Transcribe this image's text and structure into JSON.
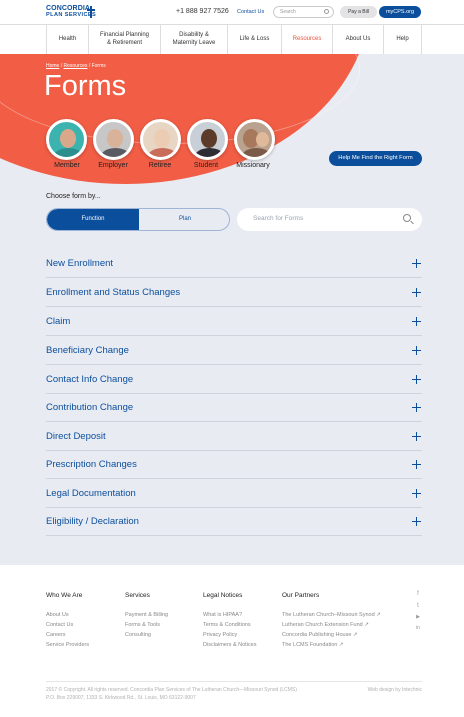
{
  "header": {
    "logo_line1": "CONCORDIA",
    "logo_line2": "PLAN SERVICES",
    "phone": "+1 888 927 7526",
    "contact": "Contact Us",
    "search_placeholder": "Search",
    "pay_bill": "Pay a Bill",
    "mycps": "myCPS.org"
  },
  "nav": [
    {
      "label": "Health"
    },
    {
      "label": "Financial Planning\n& Retirement"
    },
    {
      "label": "Disability &\nMaternity Leave"
    },
    {
      "label": "Life & Loss"
    },
    {
      "label": "Resources"
    },
    {
      "label": "About Us"
    },
    {
      "label": "Help"
    }
  ],
  "breadcrumb": {
    "home": "Home",
    "sep": "/",
    "resources": "Resources",
    "current": "Forms"
  },
  "page_title": "Forms",
  "audiences": [
    {
      "label": "Member"
    },
    {
      "label": "Employer"
    },
    {
      "label": "Retiree"
    },
    {
      "label": "Student"
    },
    {
      "label": "Missionary"
    }
  ],
  "help_button": "Help Me Find the Right Form",
  "choose_label": "Choose form by...",
  "toggle": {
    "function": "Function",
    "plan": "Plan"
  },
  "forms_search_placeholder": "Search for Forms",
  "accordion": [
    "New Enrollment",
    "Enrollment and Status Changes",
    "Claim",
    "Beneficiary Change",
    "Contact Info Change",
    "Contribution Change",
    "Direct Deposit",
    "Prescription Changes",
    "Legal Documentation",
    "Eligibility / Declaration"
  ],
  "footer": {
    "columns": [
      {
        "title": "Who We Are",
        "links": [
          "About Us",
          "Contact Us",
          "Careers",
          "Service Providers"
        ]
      },
      {
        "title": "Services",
        "links": [
          "Payment & Billing",
          "Forms & Tools",
          "Consulting"
        ]
      },
      {
        "title": "Legal Notices",
        "links": [
          "What is HIPAA?",
          "Terms & Conditions",
          "Privacy Policy",
          "Disclaimers & Notices"
        ]
      },
      {
        "title": "Our Partners",
        "links": [
          "The Lutheran Church–Missouri Synod ↗",
          "Lutheran Church Extension Fund ↗",
          "Concordia Publishing House ↗",
          "The LCMS Foundation ↗"
        ]
      }
    ],
    "social": [
      {
        "icon": "facebook-icon",
        "glyph": "f"
      },
      {
        "icon": "twitter-icon",
        "glyph": "t"
      },
      {
        "icon": "youtube-icon",
        "glyph": "▶"
      },
      {
        "icon": "linkedin-icon",
        "glyph": "in"
      }
    ],
    "copyright_line1": "2017 © Copyright. All rights reserved. Concordia Plan Services of The Lutheran Church—Missouri Synod (LCMS)",
    "copyright_line2": "P.O. Box 229007, 1333 S. Kirkwood Rd., St. Louis, MO 63122-9007",
    "credit": "Web design by Intechnic"
  },
  "colors": {
    "brand_blue": "#0b4f9c",
    "accent_coral": "#f15d45",
    "hero_bg": "#e9ebf2"
  }
}
